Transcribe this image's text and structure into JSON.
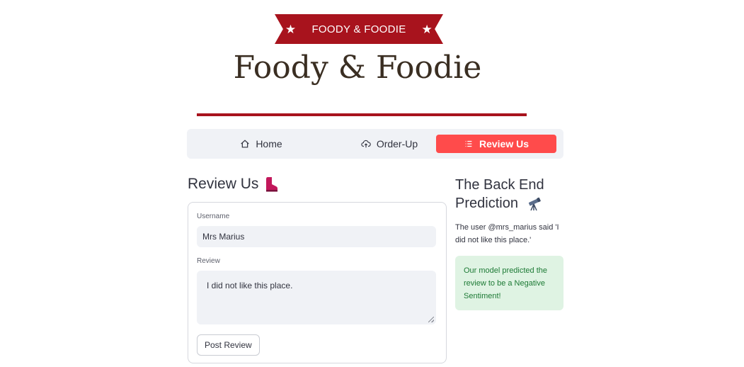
{
  "banner": {
    "text": "FOODY & FOODIE",
    "left_star": "★",
    "right_star": "★"
  },
  "brand": {
    "title": "Foody & Foodie",
    "accent_color": "#a8131d"
  },
  "nav": {
    "items": [
      {
        "label": "Home",
        "icon": "home-icon",
        "active": false
      },
      {
        "label": "Order-Up",
        "icon": "cloud-upload-icon",
        "active": false
      },
      {
        "label": "Review Us",
        "icon": "list-icon",
        "active": true
      }
    ],
    "active_color": "#ff4b4b"
  },
  "review_form": {
    "title": "Review Us",
    "title_icon": "boot-icon",
    "username_label": "Username",
    "username_value": "Mrs Marius",
    "review_label": "Review",
    "review_value": "I did not like this place.",
    "post_button": "Post Review"
  },
  "prediction_panel": {
    "title_line1": "The Back End",
    "title_line2": "Prediction",
    "title_icon": "telescope-icon",
    "said_text": "The user @mrs_marius said 'I did not like this place.'",
    "result_text": "Our model predicted the review to be a Negative Sentiment!",
    "result_color": "#1d7a35"
  }
}
